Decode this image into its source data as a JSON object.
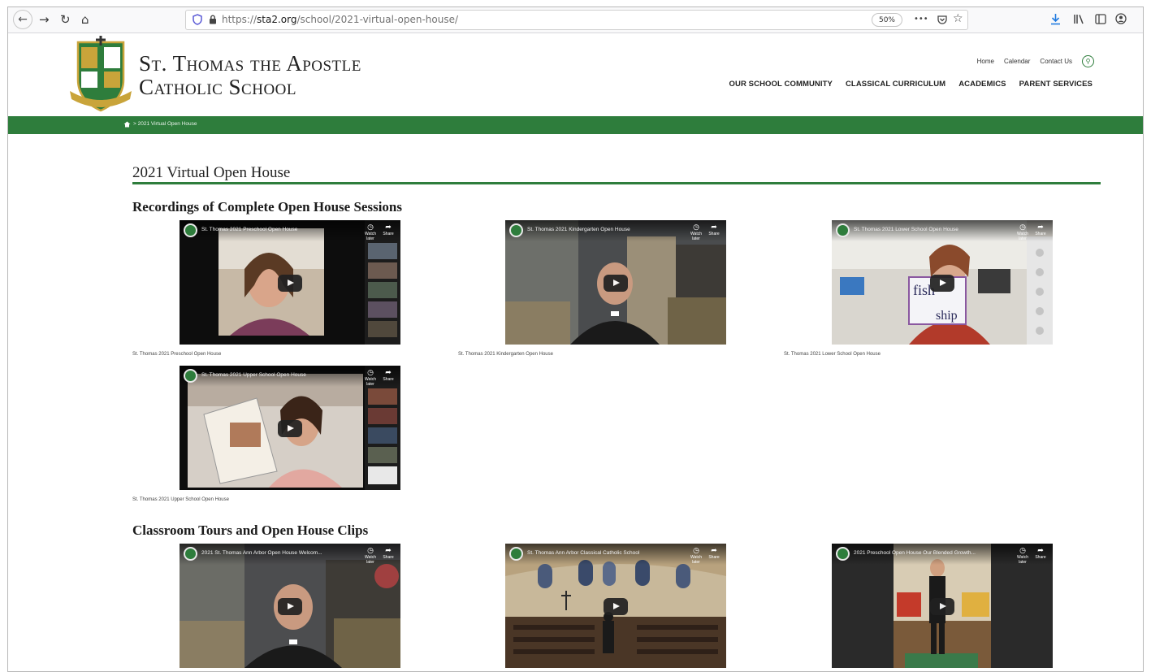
{
  "browser": {
    "url_prefix": "https://",
    "url_domain": "sta2.org",
    "url_path": "/school/2021-virtual-open-house/",
    "zoom": "50%",
    "more_icon": "•••"
  },
  "site": {
    "name_line1": "St. Thomas the Apostle",
    "name_line2": "Catholic School",
    "util_nav": [
      "Home",
      "Calendar",
      "Contact Us"
    ],
    "main_nav": [
      "OUR SCHOOL COMMUNITY",
      "CLASSICAL CURRICULUM",
      "ACADEMICS",
      "PARENT SERVICES"
    ]
  },
  "breadcrumb": {
    "text": "> 2021 Virtual Open House"
  },
  "page": {
    "title": "2021 Virtual Open House",
    "section1": "Recordings of Complete Open House Sessions",
    "section2": "Classroom Tours and Open House Clips"
  },
  "videos": [
    {
      "title": "St. Thomas 2021 Preschool Open House",
      "caption": "St. Thomas 2021 Preschool Open House"
    },
    {
      "title": "St. Thomas 2021 Kindergarten Open House",
      "caption": "St. Thomas 2021 Kindergarten Open House"
    },
    {
      "title": "St. Thomas 2021 Lower School Open House",
      "caption": "St. Thomas 2021 Lower School Open House"
    },
    {
      "title": "St. Thomas 2021 Upper School Open House",
      "caption": "St. Thomas 2021 Upper School Open House"
    },
    {
      "title": "2021 St. Thomas Ann Arbor Open House Welcom..."
    },
    {
      "title": "St. Thomas Ann Arbor Classical Catholic School"
    },
    {
      "title": "2021 Preschool Open House Our Blended Growth..."
    }
  ],
  "video_overlay": {
    "watch_later": "Watch later",
    "share": "Share"
  },
  "video_scene_text": {
    "fish": "fish",
    "ship": "ship"
  },
  "colors": {
    "brand_green": "#2e7d3c",
    "video_bg": "#121212"
  }
}
